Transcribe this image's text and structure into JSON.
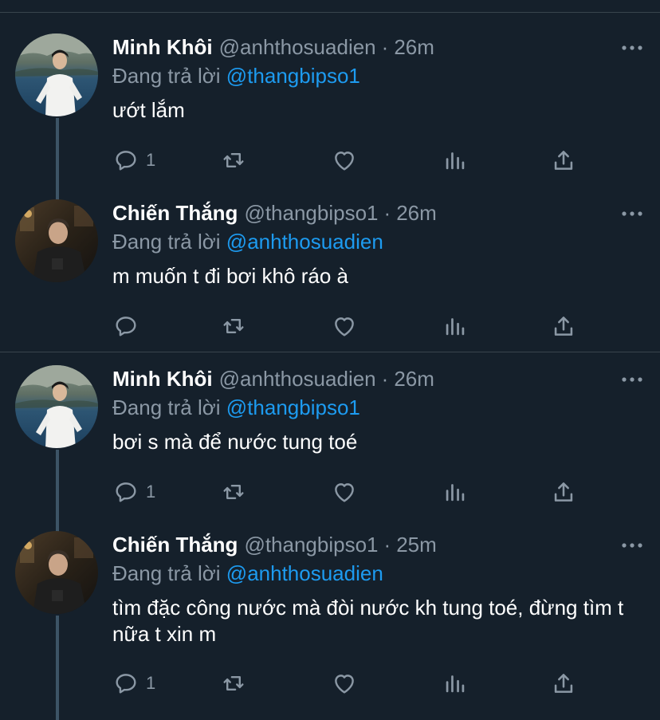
{
  "tweets": [
    {
      "name": "Minh Khôi",
      "handle": "@anhthosuadien",
      "sep": "·",
      "time": "26m",
      "reply_prefix": "Đang trả lời",
      "reply_to": "@thangbipso1",
      "text": "ướt lắm",
      "reply_count": "1",
      "avatar": "avatar-minh-khoi"
    },
    {
      "name": "Chiến Thắng",
      "handle": "@thangbipso1",
      "sep": "·",
      "time": "26m",
      "reply_prefix": "Đang trả lời",
      "reply_to": "@anhthosuadien",
      "text": "m muốn t đi bơi khô ráo à",
      "reply_count": "",
      "avatar": "avatar-chien-thang"
    },
    {
      "name": "Minh Khôi",
      "handle": "@anhthosuadien",
      "sep": "·",
      "time": "26m",
      "reply_prefix": "Đang trả lời",
      "reply_to": "@thangbipso1",
      "text": "bơi s mà để nước tung toé",
      "reply_count": "1",
      "avatar": "avatar-minh-khoi"
    },
    {
      "name": "Chiến Thắng",
      "handle": "@thangbipso1",
      "sep": "·",
      "time": "25m",
      "reply_prefix": "Đang trả lời",
      "reply_to": "@anhthosuadien",
      "text": "tìm đặc công nước mà đòi nước kh tung toé, đừng tìm t nữa t xin m",
      "reply_count": "1",
      "avatar": "avatar-chien-thang"
    }
  ],
  "icons": {
    "reply": "comment-icon",
    "retweet": "retweet-icon",
    "like": "heart-icon",
    "views": "bar-chart-icon",
    "share": "share-icon",
    "more": "more-dots-icon"
  },
  "colors": {
    "background": "#15202b",
    "divider": "#38444d",
    "secondary_text": "#8b98a5",
    "mention": "#1d9bf0",
    "thread_line": "#3d5466"
  }
}
